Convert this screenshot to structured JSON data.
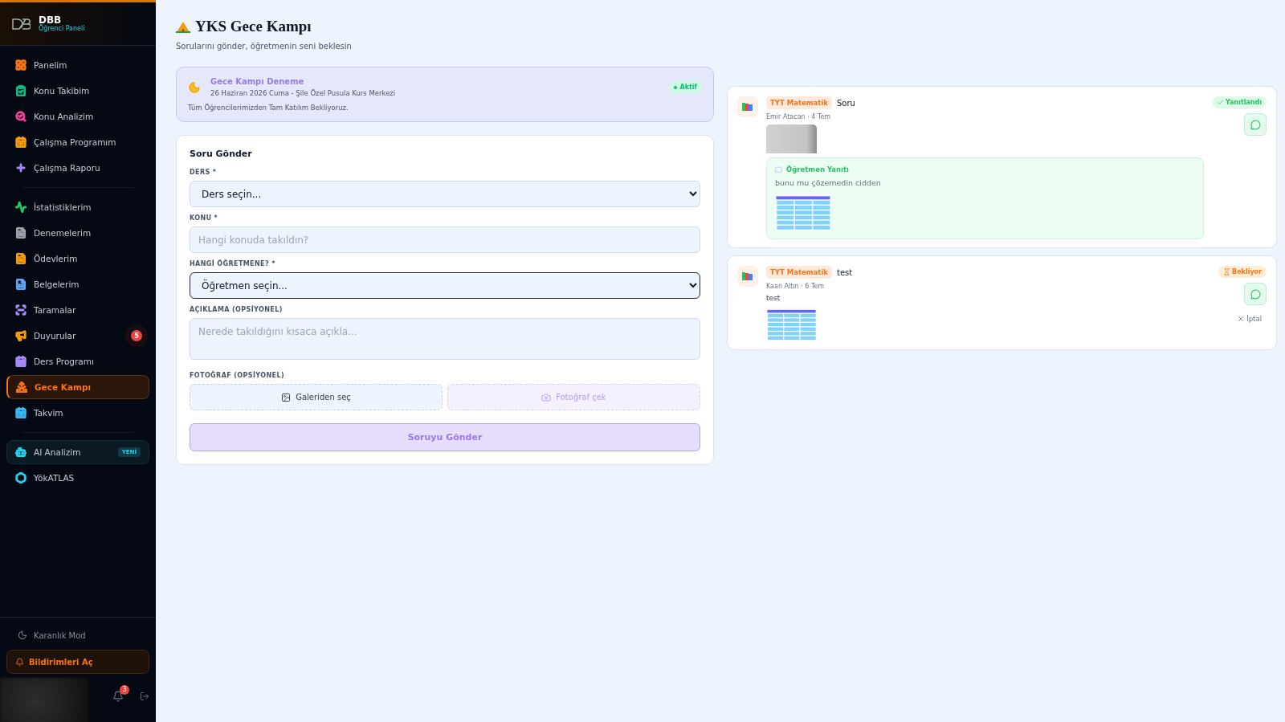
{
  "brand": {
    "title": "DBB",
    "subtitle": "Öğrenci Paneli"
  },
  "sidebar": {
    "groups": [
      {
        "items": [
          {
            "label": "Panelim",
            "color": "#f97316",
            "selected": false
          },
          {
            "label": "Konu Takibim",
            "color": "#10b981",
            "selected": false
          },
          {
            "label": "Konu Analizim",
            "color": "#ec4899",
            "selected": false
          },
          {
            "label": "Çalışma Programım",
            "color": "#f59e0b",
            "selected": false
          },
          {
            "label": "Çalışma Raporu",
            "color": "#a78bfa",
            "selected": false
          }
        ]
      },
      {
        "items": [
          {
            "label": "İstatistiklerim",
            "color": "#22c55e",
            "selected": false
          },
          {
            "label": "Denemelerim",
            "color": "#9ca3af",
            "selected": false
          },
          {
            "label": "Ödevlerim",
            "color": "#f59e0b",
            "selected": false
          },
          {
            "label": "Belgelerim",
            "color": "#60a5fa",
            "selected": false
          },
          {
            "label": "Taramalar",
            "color": "#a78bfa",
            "selected": false
          },
          {
            "label": "Duyurular",
            "color": "#f59e0b",
            "selected": false,
            "badge": "5"
          },
          {
            "label": "Ders Programı",
            "color": "#a78bfa",
            "selected": false
          },
          {
            "label": "Gece Kampı",
            "color": "#f97316",
            "selected": true
          },
          {
            "label": "Takvim",
            "color": "#38bdf8",
            "selected": false
          }
        ]
      },
      {
        "items": [
          {
            "label": "AI Analizim",
            "color": "#22d3ee",
            "selected": false,
            "tag": "YENİ"
          },
          {
            "label": "YökATLAS",
            "color": "#22d3ee",
            "selected": false
          }
        ]
      }
    ],
    "footer": {
      "dark_mode": "Karanlık Mod",
      "notify_button": "Bildirimleri Aç",
      "bell_badge": "3"
    }
  },
  "header": {
    "title": "YKS Gece Kampı",
    "subtitle": "Sorularını gönder, öğretmenin seni beklesin"
  },
  "camp": {
    "title": "Gece Kampı Deneme",
    "date": "26 Haziran 2026 Cuma - Şile Özel Pusula Kurs Merkezi",
    "note": "Tüm Öğrencilerimizden Tam Katılım Bekliyoruz.",
    "status": "Aktif",
    "active": true
  },
  "form": {
    "title": "Soru Gönder",
    "fields": [
      {
        "kind": "select",
        "label": "DERS *",
        "value": "Ders seçin...",
        "focused": false
      },
      {
        "kind": "input",
        "label": "KONU *",
        "placeholder": "Hangi konuda takıldın?",
        "focused": false
      },
      {
        "kind": "select",
        "label": "HANGİ ÖĞRETMENE? *",
        "value": "Öğretmen seçin...",
        "focused": true
      },
      {
        "kind": "textarea",
        "label": "AÇIKLAMA (OPSİYONEL)",
        "placeholder": "Nerede takıldığını kısaca açıkla...",
        "focused": false
      }
    ],
    "photo_label": "FOTOĞRAF (OPSİYONEL)",
    "gallery_button": "Galeriden seç",
    "camera_button": "Fotoğraf çek",
    "submit": {
      "label": "Soruyu Gönder",
      "disabled": true
    }
  },
  "questions": [
    {
      "subject": "TYT Matematik",
      "title": "Soru",
      "meta": "Emir Atacan · 4 Tem",
      "kind": "photo",
      "status": {
        "kind": "answered",
        "label": "Yanıtlandı"
      },
      "reply": {
        "title": "Öğretmen Yanıtı",
        "text": "bunu mu çözemedin cidden"
      }
    },
    {
      "subject": "TYT Matematik",
      "title": "test",
      "meta": "Kaan Altın · 6 Tem",
      "body": "test",
      "kind": "table",
      "status": {
        "kind": "pending",
        "label": "Bekliyor"
      },
      "cancel": "İptal"
    }
  ]
}
